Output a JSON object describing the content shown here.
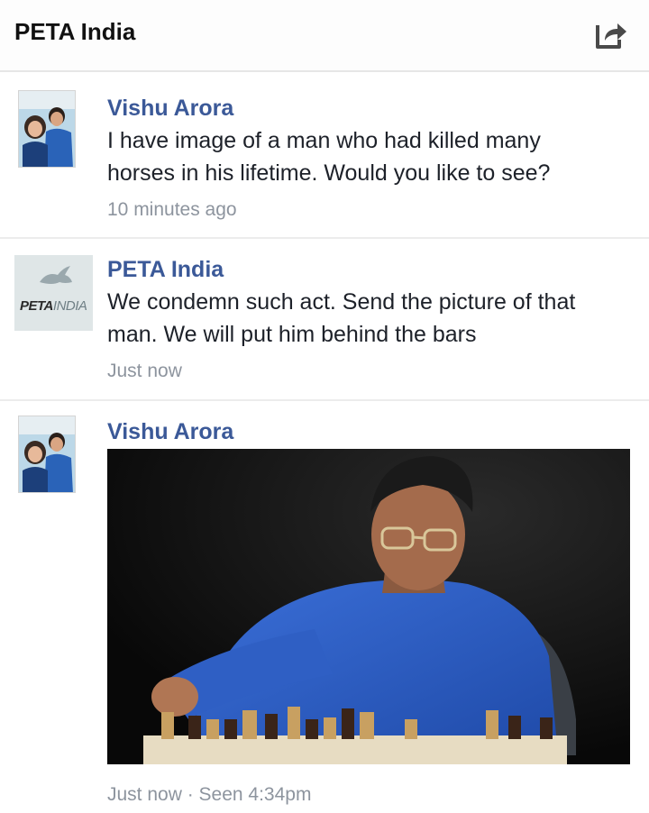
{
  "header": {
    "title": "PETA India",
    "share_icon": "share-arrow-icon"
  },
  "messages": [
    {
      "sender": "Vishu Arora",
      "text_lines": [
        "I have image of a man who had killed many",
        "horses in his lifetime. Would you like to see?"
      ],
      "time": "10 minutes ago",
      "avatar": "user-photo-avatar"
    },
    {
      "sender": "PETA India",
      "text_lines": [
        "We condemn such act. Send the picture of that",
        "man. We will put him behind the bars"
      ],
      "time": "Just now",
      "avatar": {
        "logo_text_a": "PETA",
        "logo_text_b": "INDIA",
        "icon": "rabbit-icon"
      }
    },
    {
      "sender": "Vishu Arora",
      "attachment": "photo of man in blue shirt playing chess",
      "time": "Just now · Seen 4:34pm",
      "avatar": "user-photo-avatar"
    }
  ],
  "colors": {
    "sender_name": "#3b5998",
    "timestamp": "#8d949e",
    "divider": "#ececec",
    "shirt_blue": "#2f5fc4"
  }
}
